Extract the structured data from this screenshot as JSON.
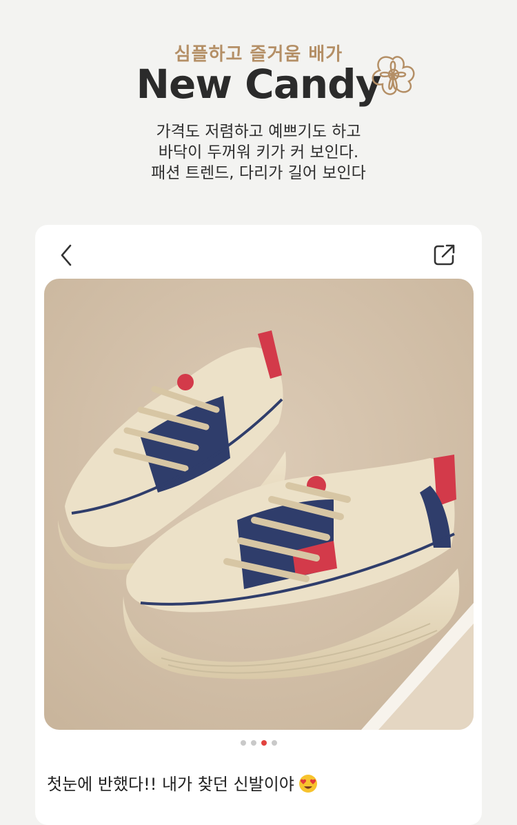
{
  "header": {
    "subtitle": "심플하고 즐거움 배가",
    "brand": "New Candy",
    "description_lines": [
      "가격도 저렴하고 예쁘기도 하고",
      "바닥이 두꺼워 키가 커 보인다.",
      "패션 트렌드, 다리가 길어 보인다"
    ]
  },
  "post": {
    "nav": {
      "back_icon": "chevron-left-icon",
      "share_icon": "share-icon"
    },
    "carousel": {
      "count": 4,
      "active_index": 2
    },
    "caption": "첫눈에 반했다!! 내가 찾던 신발이야",
    "caption_emoji": "heart-eyes-emoji"
  },
  "colors": {
    "background": "#f3f3f1",
    "subtitle": "#b48f66",
    "brand": "#2b2b2b",
    "active_dot": "#e2433f",
    "inactive_dot": "#c9c9c9",
    "shoe_navy": "#2f3d6b",
    "shoe_red": "#d33a4a",
    "shoe_cream": "#ece1c8"
  }
}
